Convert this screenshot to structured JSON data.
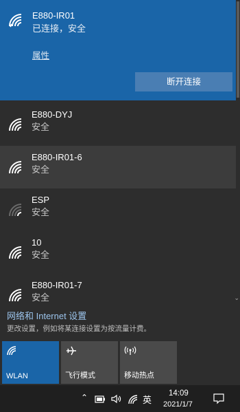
{
  "connected": {
    "name": "E880-IR01",
    "status": "已连接，安全",
    "properties_label": "属性",
    "disconnect_label": "断开连接"
  },
  "networks": [
    {
      "name": "E880-DYJ",
      "status": "安全"
    },
    {
      "name": "E880-IR01-6",
      "status": "安全"
    },
    {
      "name": "ESP",
      "status": "安全"
    },
    {
      "name": "10",
      "status": "安全"
    },
    {
      "name": "E880-IR01-7",
      "status": "安全"
    }
  ],
  "settings": {
    "link_label": "网络和 Internet 设置",
    "description": "更改设置，例如将某连接设置为按流量计费。"
  },
  "quick_actions": [
    {
      "label": "WLAN",
      "icon": "wifi-icon",
      "active": true
    },
    {
      "label": "飞行模式",
      "icon": "airplane-icon",
      "active": false
    },
    {
      "label": "移动热点",
      "icon": "hotspot-icon",
      "active": false
    }
  ],
  "taskbar": {
    "input_method": "英",
    "time": "14:09",
    "date": "2021/1/7"
  },
  "colors": {
    "accent": "#1a65a8",
    "link": "#9cc4ec",
    "background": "#2d2d2d"
  }
}
